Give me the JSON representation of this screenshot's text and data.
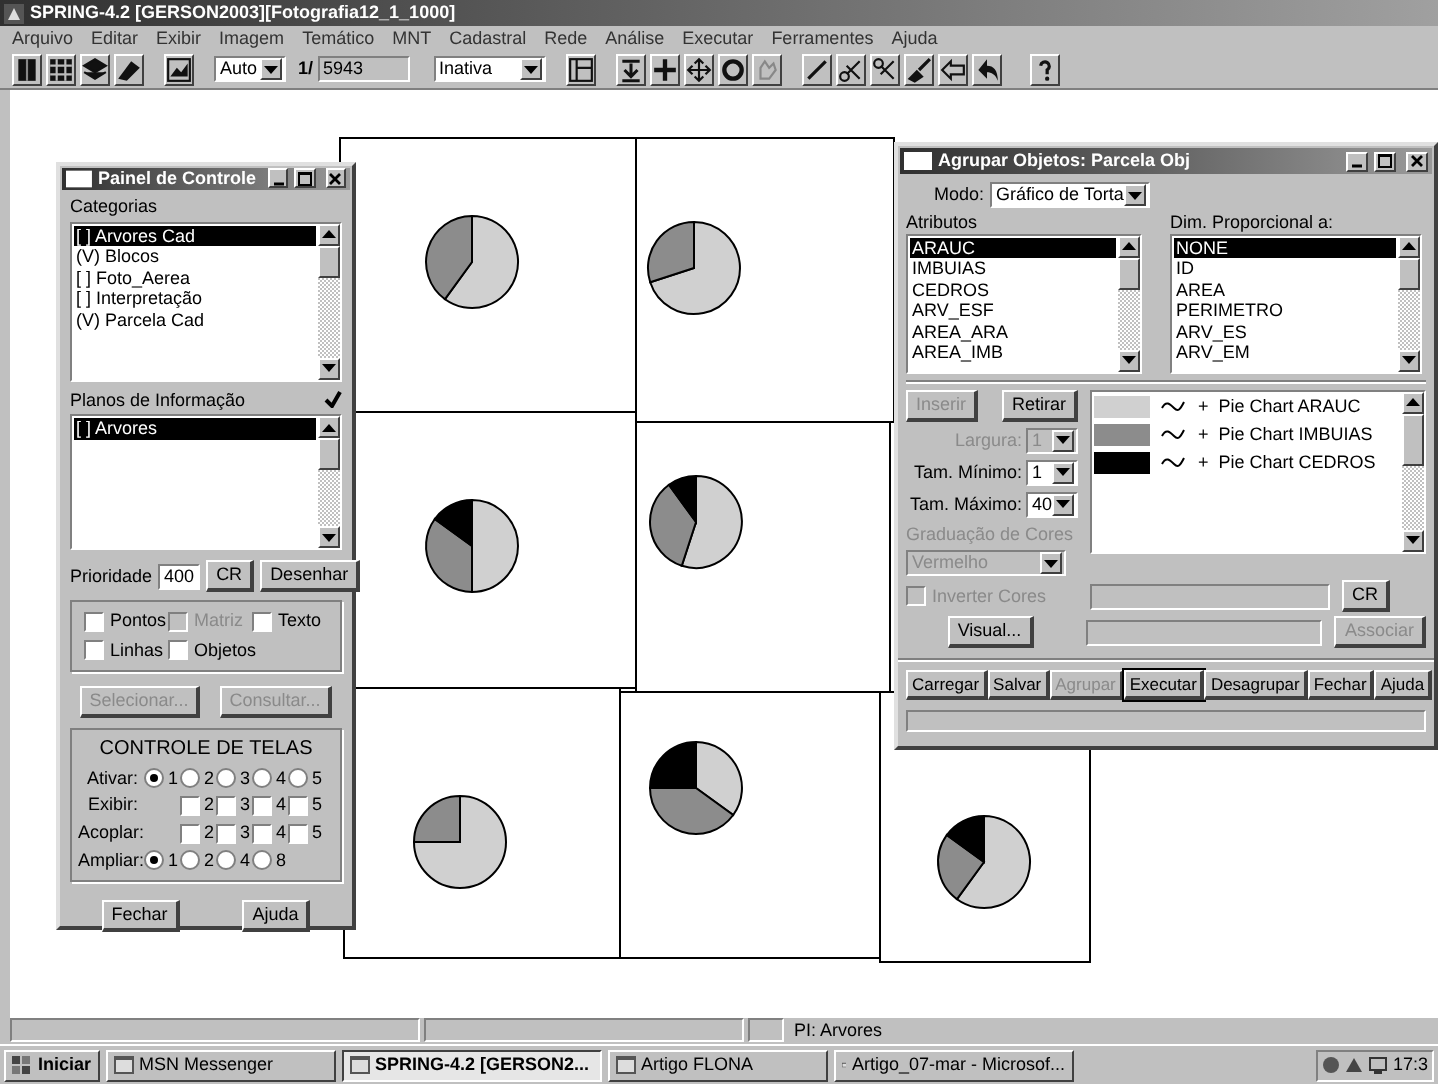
{
  "app": {
    "title": "SPRING-4.2 [GERSON2003][Fotografia12_1_1000]"
  },
  "menu": [
    "Arquivo",
    "Editar",
    "Exibir",
    "Imagem",
    "Temático",
    "MNT",
    "Cadastral",
    "Rede",
    "Análise",
    "Executar",
    "Ferramentes",
    "Ajuda"
  ],
  "toolbar": {
    "mode": "Auto",
    "scale_prefix": "1/",
    "scale": "5943",
    "state": "Inativa"
  },
  "control_panel": {
    "title": "Painel de Controle",
    "categories_label": "Categorias",
    "categories": [
      {
        "label": "[ ] Arvores Cad",
        "selected": true
      },
      {
        "label": "(V) Blocos",
        "selected": false
      },
      {
        "label": "[ ] Foto_Aerea",
        "selected": false
      },
      {
        "label": "[ ] Interpretação",
        "selected": false
      },
      {
        "label": "(V) Parcela Cad",
        "selected": false
      }
    ],
    "planes_label": "Planos de Informação",
    "planes_checked": true,
    "planes": [
      {
        "label": "[ ] Arvores",
        "selected": true
      }
    ],
    "priority_label": "Prioridade",
    "priority": "400",
    "priority_buttons": [
      {
        "label": "CR",
        "disabled": false
      },
      {
        "label": "Desenhar",
        "disabled": false
      }
    ],
    "layers": [
      {
        "label": "Pontos",
        "checked": false,
        "disabled": false
      },
      {
        "label": "Matriz",
        "checked": false,
        "disabled": true
      },
      {
        "label": "Texto",
        "checked": false,
        "disabled": false
      },
      {
        "label": "Linhas",
        "checked": false,
        "disabled": false
      },
      {
        "label": "Objetos",
        "checked": false,
        "disabled": false
      }
    ],
    "actions": [
      {
        "label": "Selecionar...",
        "disabled": true
      },
      {
        "label": "Consultar...",
        "disabled": true
      }
    ],
    "screens": {
      "title": "CONTROLE DE TELAS",
      "rows": [
        {
          "label": "Ativar:",
          "kind": "radio",
          "options": [
            {
              "label": "1",
              "selected": true
            },
            {
              "label": "2",
              "selected": false
            },
            {
              "label": "3",
              "selected": false
            },
            {
              "label": "4",
              "selected": false
            },
            {
              "label": "5",
              "selected": false
            }
          ]
        },
        {
          "label": "Exibir:",
          "kind": "check",
          "options": [
            {
              "label": "2",
              "checked": false
            },
            {
              "label": "3",
              "checked": false
            },
            {
              "label": "4",
              "checked": false
            },
            {
              "label": "5",
              "checked": false
            }
          ]
        },
        {
          "label": "Acoplar:",
          "kind": "check",
          "options": [
            {
              "label": "2",
              "checked": false
            },
            {
              "label": "3",
              "checked": false
            },
            {
              "label": "4",
              "checked": false
            },
            {
              "label": "5",
              "checked": false
            }
          ]
        },
        {
          "label": "Ampliar:",
          "kind": "radio",
          "options": [
            {
              "label": "1",
              "selected": true
            },
            {
              "label": "2",
              "selected": false
            },
            {
              "label": "4",
              "selected": false
            },
            {
              "label": "8",
              "selected": false
            }
          ]
        }
      ]
    },
    "footer": [
      {
        "label": "Fechar",
        "disabled": false
      },
      {
        "label": "Ajuda",
        "disabled": false
      }
    ]
  },
  "group_dialog": {
    "title": "Agrupar Objetos: Parcela Obj",
    "mode_label": "Modo:",
    "mode": "Gráfico de Torta",
    "attributes_label": "Atributos",
    "attributes": [
      {
        "label": "ARAUC",
        "selected": true
      },
      {
        "label": "IMBUIAS",
        "selected": false
      },
      {
        "label": "CEDROS",
        "selected": false
      },
      {
        "label": "ARV_ESF",
        "selected": false
      },
      {
        "label": "AREA_ARA",
        "selected": false
      },
      {
        "label": "AREA_IMB",
        "selected": false
      }
    ],
    "dim_label": "Dim. Proporcional a:",
    "dims": [
      {
        "label": "NONE",
        "selected": true
      },
      {
        "label": "ID",
        "selected": false
      },
      {
        "label": "AREA",
        "selected": false
      },
      {
        "label": "PERIMETRO",
        "selected": false
      },
      {
        "label": "ARV_ES",
        "selected": false
      },
      {
        "label": "ARV_EM",
        "selected": false
      }
    ],
    "edit_buttons": [
      {
        "label": "Inserir",
        "disabled": true
      },
      {
        "label": "Retirar",
        "disabled": false
      }
    ],
    "sizes": [
      {
        "label": "Largura:",
        "value": "1",
        "disabled": true
      },
      {
        "label": "Tam. Mínimo:",
        "value": "1",
        "disabled": false
      },
      {
        "label": "Tam. Máximo:",
        "value": "40",
        "disabled": false
      }
    ],
    "gradient": {
      "label": "Graduação de Cores",
      "value": "Vermelho",
      "disabled": true
    },
    "legend": [
      {
        "color": "#d0d0d0",
        "symbol": "+",
        "label": "Pie Chart ARAUC"
      },
      {
        "color": "#8c8c8c",
        "symbol": "+",
        "label": "Pie Chart IMBUIAS"
      },
      {
        "color": "#000000",
        "symbol": "+",
        "label": "Pie Chart CEDROS"
      }
    ],
    "invert": {
      "label": "Inverter Cores",
      "checked": false,
      "disabled": true
    },
    "visual_button": {
      "label": "Visual...",
      "disabled": false
    },
    "cr_button": {
      "label": "CR",
      "disabled": false
    },
    "associate_button": {
      "label": "Associar",
      "disabled": true
    },
    "buttons": [
      {
        "label": "Carregar",
        "disabled": false,
        "focused": false
      },
      {
        "label": "Salvar",
        "disabled": false,
        "focused": false
      },
      {
        "label": "Agrupar",
        "disabled": true,
        "focused": false
      },
      {
        "label": "Executar",
        "disabled": false,
        "focused": true
      },
      {
        "label": "Desagrupar",
        "disabled": false,
        "focused": false
      },
      {
        "label": "Fechar",
        "disabled": false,
        "focused": false
      },
      {
        "label": "Ajuda",
        "disabled": false,
        "focused": false
      }
    ]
  },
  "status_bar": {
    "text": "PI: Arvores"
  },
  "taskbar": {
    "start": "Iniciar",
    "tasks": [
      {
        "label": "MSN Messenger",
        "selected": false
      },
      {
        "label": "SPRING-4.2 [GERSON2...",
        "selected": true
      },
      {
        "label": "Artigo FLONA",
        "selected": false
      },
      {
        "label": "Artigo_07-mar - Microsof...",
        "selected": false
      }
    ],
    "clock": "17:3"
  }
}
